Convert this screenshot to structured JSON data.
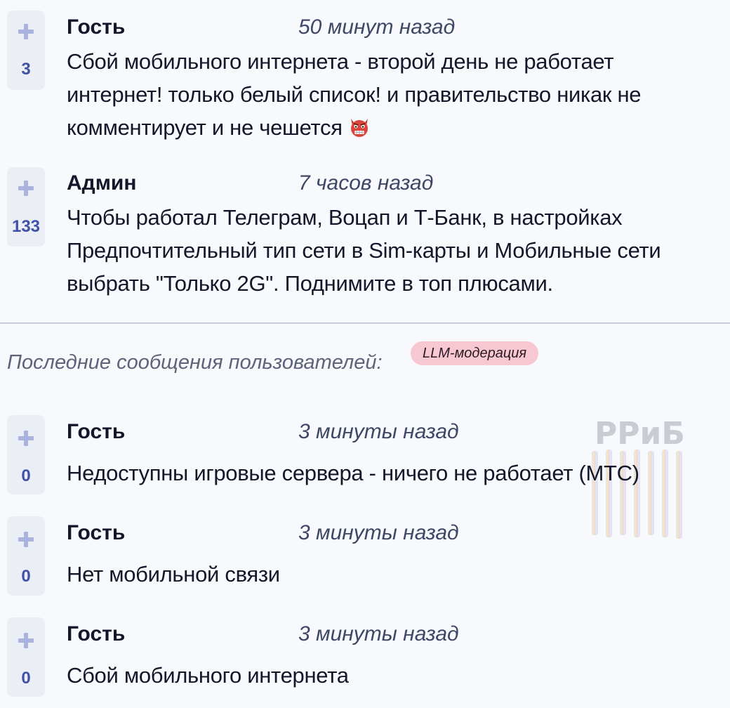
{
  "top_comments": [
    {
      "votes": "3",
      "author": "Гость",
      "time": "50 минут назад",
      "lines": [
        "Сбой мобильного интернета - второй день не работает",
        "интернет! только белый список! и правительство никак не",
        "комментирует и не чешется"
      ],
      "emoji": "devil-face-icon"
    },
    {
      "votes": "133",
      "author": "Админ",
      "time": "7 часов назад",
      "lines": [
        "Чтобы работал Телеграм, Воцап и Т-Банк, в настройках",
        "Предпочтительный тип сети в Sim-карты и Мобильные сети",
        "выбрать \"Только 2G\". Поднимите в топ плюсами."
      ]
    }
  ],
  "recent": {
    "title": "Последние сообщения пользователей:",
    "badge": "LLM-модерация",
    "watermark": "РРиБ",
    "items": [
      {
        "votes": "0",
        "author": "Гость",
        "time": "3 минуты назад",
        "text": "Недоступны игровые сервера - ничего не работает (МТС)"
      },
      {
        "votes": "0",
        "author": "Гость",
        "time": "3 минуты назад",
        "text": "Нет мобильной связи"
      },
      {
        "votes": "0",
        "author": "Гость",
        "time": "3 минуты назад",
        "text": "Сбой мобильного интернета"
      }
    ]
  },
  "colors": {
    "background": "#f8f9fc",
    "vote_box": "#eceef6",
    "vote_count": "#4052a8",
    "plus": "#aab3de",
    "badge": "#f7c8d2"
  }
}
